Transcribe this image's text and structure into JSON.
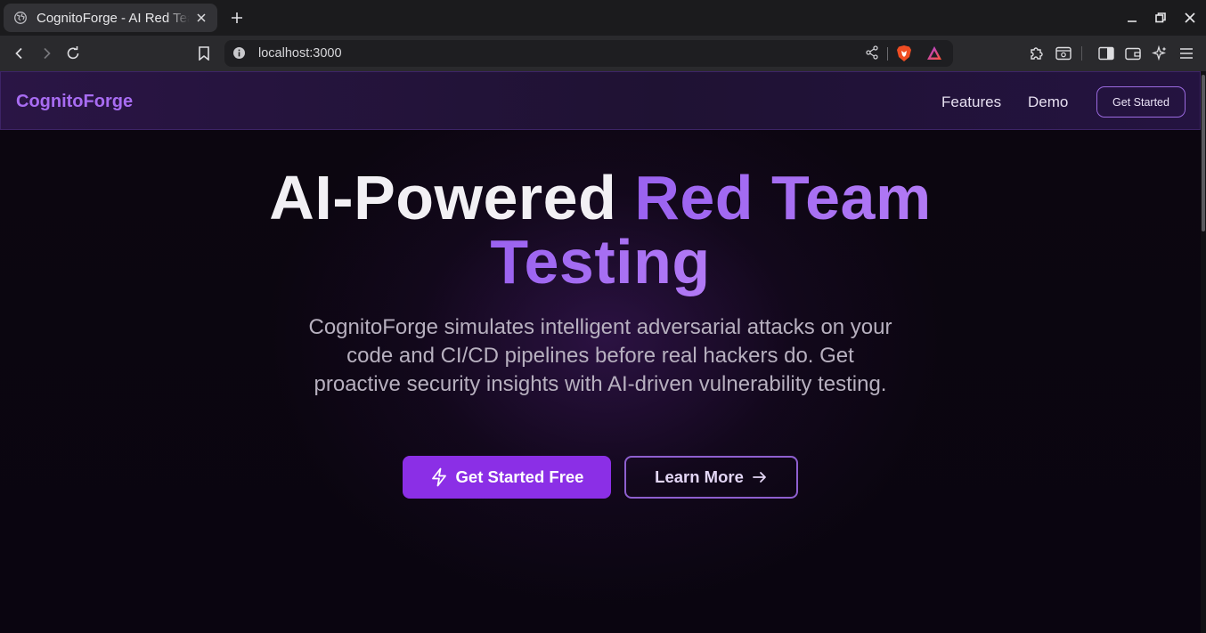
{
  "browser": {
    "tab_title": "CognitoForge - AI Red Team Testing",
    "url": "localhost:3000"
  },
  "nav": {
    "logo": "CognitoForge",
    "links": [
      "Features",
      "Demo"
    ],
    "cta": "Get Started"
  },
  "hero": {
    "title_plain": "AI-Powered ",
    "title_accent": "Red Team",
    "title_line2": "Testing",
    "subtitle": "CognitoForge simulates intelligent adversarial attacks on your code and CI/CD pipelines before real hackers do. Get proactive security insights with AI-driven vulnerability testing.",
    "primary_button": "Get Started Free",
    "secondary_button": "Learn More"
  },
  "colors": {
    "accent": "#a86cf2",
    "primary_button": "#8b2fe6",
    "nav_bg": "#241340"
  }
}
